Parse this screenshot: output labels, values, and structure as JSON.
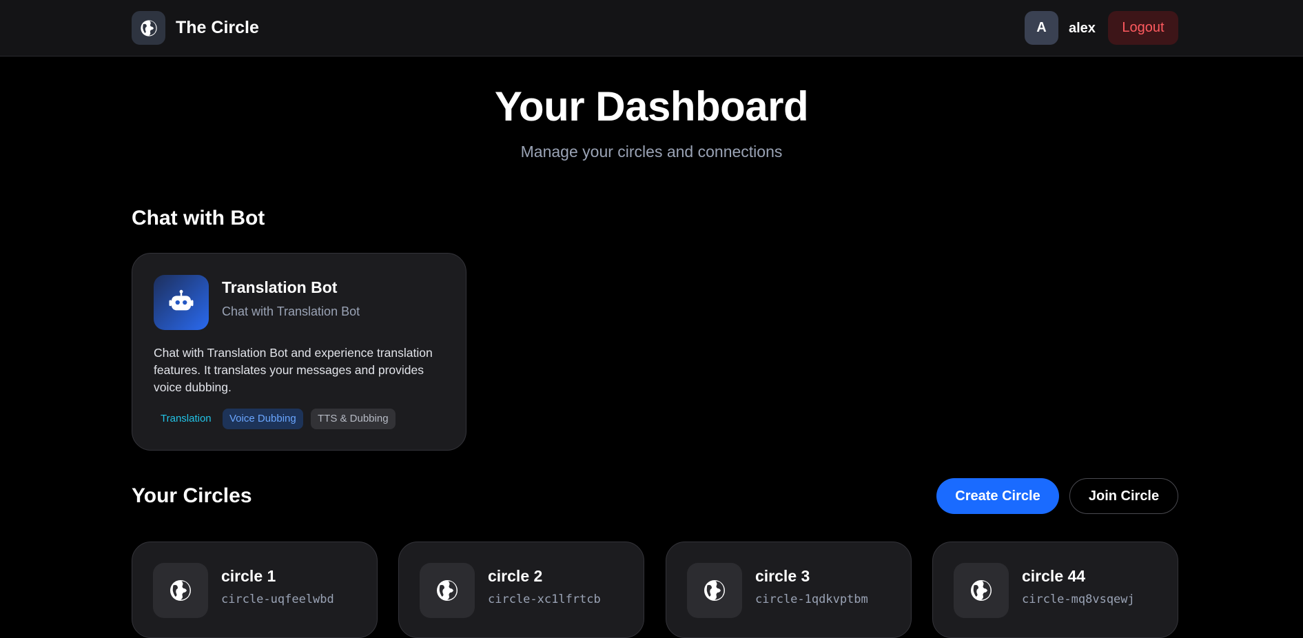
{
  "header": {
    "brand_title": "The Circle",
    "brand_icon": "globe-icon",
    "user_initial": "A",
    "username": "alex",
    "logout_label": "Logout"
  },
  "page": {
    "title": "Your Dashboard",
    "subtitle": "Manage your circles and connections"
  },
  "bot_section": {
    "title": "Chat with Bot",
    "card": {
      "name": "Translation Bot",
      "subtitle": "Chat with Translation Bot",
      "description": "Chat with Translation Bot and experience translation features. It translates your messages and provides voice dubbing.",
      "icon": "robot-icon",
      "tags": [
        "Translation",
        "Voice Dubbing",
        "TTS & Dubbing"
      ]
    }
  },
  "circles_section": {
    "title": "Your Circles",
    "create_label": "Create Circle",
    "join_label": "Join Circle",
    "circles": [
      {
        "name": "circle 1",
        "code": "circle-uqfeelwbd"
      },
      {
        "name": "circle 2",
        "code": "circle-xc1lfrtcb"
      },
      {
        "name": "circle 3",
        "code": "circle-1qdkvptbm"
      },
      {
        "name": "circle 44",
        "code": "circle-mq8vsqewj"
      }
    ]
  },
  "colors": {
    "background": "#000000",
    "accent": "#1a6bff",
    "logout": "#ff5a5f"
  }
}
